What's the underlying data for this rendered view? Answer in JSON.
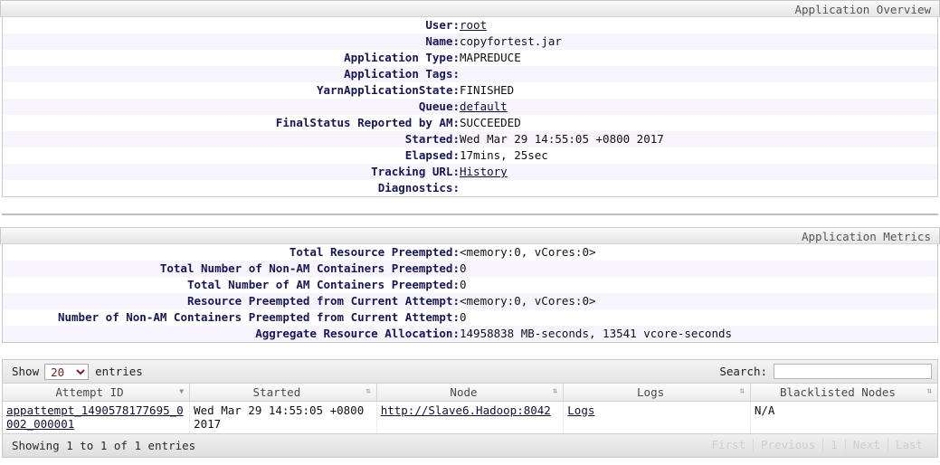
{
  "overview": {
    "title": "Application Overview",
    "rows": [
      {
        "key": "User:",
        "value": "root",
        "link": true
      },
      {
        "key": "Name:",
        "value": "copyfortest.jar",
        "link": false
      },
      {
        "key": "Application Type:",
        "value": "MAPREDUCE",
        "link": false
      },
      {
        "key": "Application Tags:",
        "value": "",
        "link": false
      },
      {
        "key": "YarnApplicationState:",
        "value": "FINISHED",
        "link": false
      },
      {
        "key": "Queue:",
        "value": "default",
        "link": true
      },
      {
        "key": "FinalStatus Reported by AM:",
        "value": "SUCCEEDED",
        "link": false
      },
      {
        "key": "Started:",
        "value": "Wed Mar 29 14:55:05 +0800 2017",
        "link": false
      },
      {
        "key": "Elapsed:",
        "value": "17mins, 25sec",
        "link": false
      },
      {
        "key": "Tracking URL:",
        "value": "History",
        "link": true
      },
      {
        "key": "Diagnostics:",
        "value": "",
        "link": false
      }
    ]
  },
  "metrics": {
    "title": "Application Metrics",
    "rows": [
      {
        "key": "Total Resource Preempted:",
        "value": "<memory:0, vCores:0>"
      },
      {
        "key": "Total Number of Non-AM Containers Preempted:",
        "value": "0"
      },
      {
        "key": "Total Number of AM Containers Preempted:",
        "value": "0"
      },
      {
        "key": "Resource Preempted from Current Attempt:",
        "value": "<memory:0, vCores:0>"
      },
      {
        "key": "Number of Non-AM Containers Preempted from Current Attempt:",
        "value": "0"
      },
      {
        "key": "Aggregate Resource Allocation:",
        "value": "14958838 MB-seconds, 13541 vcore-seconds"
      }
    ]
  },
  "attempts_table": {
    "length_label_pre": "Show",
    "length_value": "20",
    "length_options": [
      "20",
      "40",
      "60",
      "80",
      "100"
    ],
    "length_label_post": "entries",
    "search_label": "Search:",
    "search_value": "",
    "search_placeholder": "",
    "columns": [
      {
        "label": "Attempt ID",
        "sort": "desc"
      },
      {
        "label": "Started",
        "sort": "none"
      },
      {
        "label": "Node",
        "sort": "none"
      },
      {
        "label": "Logs",
        "sort": "none"
      },
      {
        "label": "Blacklisted Nodes",
        "sort": "none"
      }
    ],
    "rows": [
      {
        "attempt_id": "appattempt_1490578177695_0002_000001",
        "started": "Wed Mar 29 14:55:05 +0800 2017",
        "node": "http://Slave6.Hadoop:8042",
        "logs": "Logs",
        "blacklisted_nodes": "N/A"
      }
    ],
    "info": "Showing 1 to 1 of 1 entries",
    "paginate": {
      "first": "First",
      "previous": "Previous",
      "page": "1",
      "next": "Next",
      "last": "Last"
    }
  },
  "icons": {
    "sort_desc": "▼",
    "sort_none": "⇅"
  }
}
